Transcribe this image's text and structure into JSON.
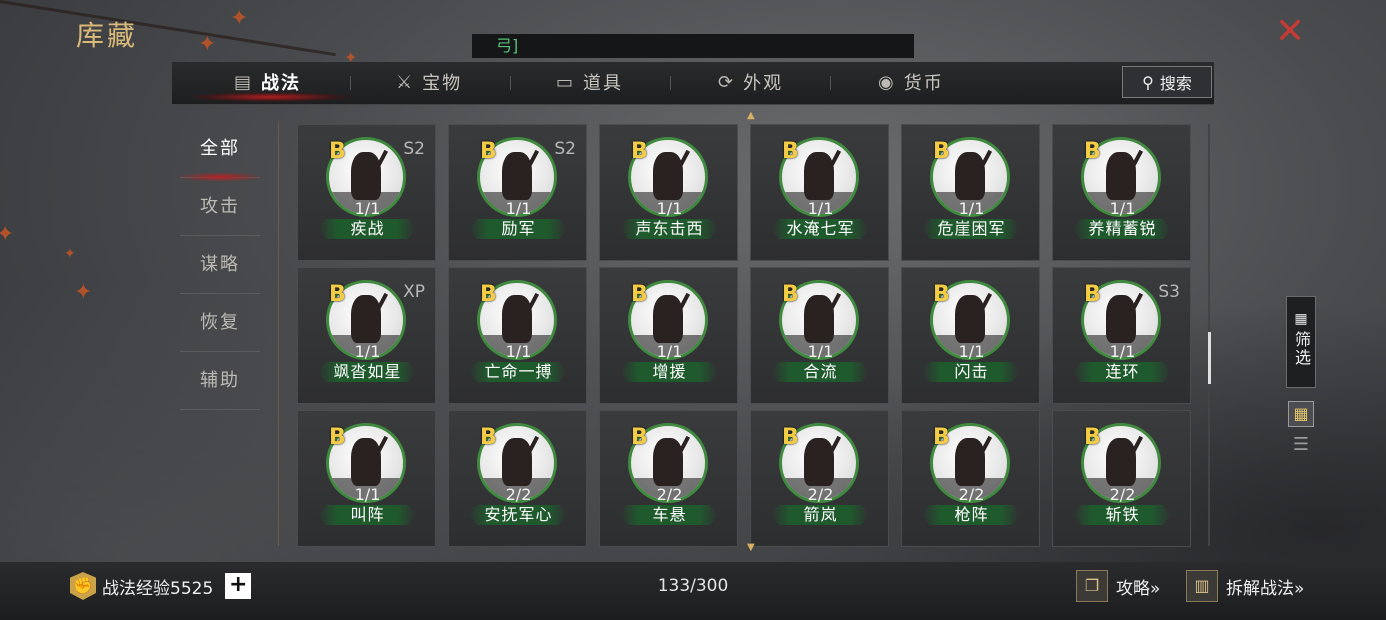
{
  "header": {
    "title": "库藏",
    "notice": "弓]",
    "close_label": "✕"
  },
  "tabs": [
    {
      "label": "战法",
      "icon": "scroll-icon",
      "glyph": "▤",
      "active": true
    },
    {
      "label": "宝物",
      "icon": "treasure-icon",
      "glyph": "⚔",
      "active": false
    },
    {
      "label": "道具",
      "icon": "item-icon",
      "glyph": "▭",
      "active": false
    },
    {
      "label": "外观",
      "icon": "appearance-icon",
      "glyph": "⟳",
      "active": false
    },
    {
      "label": "货币",
      "icon": "currency-icon",
      "glyph": "◉",
      "active": false
    }
  ],
  "search": {
    "label": "搜索",
    "icon": "search-icon"
  },
  "sidebar": {
    "items": [
      {
        "label": "全部",
        "active": true
      },
      {
        "label": "攻击",
        "active": false
      },
      {
        "label": "谋略",
        "active": false
      },
      {
        "label": "恢复",
        "active": false
      },
      {
        "label": "辅助",
        "active": false
      }
    ]
  },
  "cards": [
    {
      "grade": "B",
      "season": "S2",
      "count": "1/1",
      "name": "疾战"
    },
    {
      "grade": "B",
      "season": "S2",
      "count": "1/1",
      "name": "励军"
    },
    {
      "grade": "B",
      "season": "",
      "count": "1/1",
      "name": "声东击西"
    },
    {
      "grade": "B",
      "season": "",
      "count": "1/1",
      "name": "水淹七军"
    },
    {
      "grade": "B",
      "season": "",
      "count": "1/1",
      "name": "危崖困军"
    },
    {
      "grade": "B",
      "season": "",
      "count": "1/1",
      "name": "养精蓄锐"
    },
    {
      "grade": "B",
      "season": "XP",
      "count": "1/1",
      "name": "飒沓如星"
    },
    {
      "grade": "B",
      "season": "",
      "count": "1/1",
      "name": "亡命一搏"
    },
    {
      "grade": "B",
      "season": "",
      "count": "1/1",
      "name": "增援"
    },
    {
      "grade": "B",
      "season": "",
      "count": "1/1",
      "name": "合流"
    },
    {
      "grade": "B",
      "season": "",
      "count": "1/1",
      "name": "闪击"
    },
    {
      "grade": "B",
      "season": "S3",
      "count": "1/1",
      "name": "连环"
    },
    {
      "grade": "B",
      "season": "",
      "count": "1/1",
      "name": "叫阵"
    },
    {
      "grade": "B",
      "season": "",
      "count": "2/2",
      "name": "安抚军心"
    },
    {
      "grade": "B",
      "season": "",
      "count": "2/2",
      "name": "车悬"
    },
    {
      "grade": "B",
      "season": "",
      "count": "2/2",
      "name": "箭岚"
    },
    {
      "grade": "B",
      "season": "",
      "count": "2/2",
      "name": "枪阵"
    },
    {
      "grade": "B",
      "season": "",
      "count": "2/2",
      "name": "斩铁"
    }
  ],
  "filter": {
    "label": "筛选",
    "icon": "filter-icon"
  },
  "view": {
    "grid_icon": "grid-view-icon",
    "list_icon": "list-view-icon"
  },
  "bottom": {
    "exp_label": "战法经验5525",
    "plus": "+",
    "capacity": "133/300",
    "guide": "攻略»",
    "dismantle": "拆解战法»"
  },
  "colors": {
    "grade_gold": "#f3cb45",
    "title_gold": "#d9b97a",
    "close_red": "#c43a34",
    "notice_green": "#58c07a",
    "name_bar_green": "#1f5a2d",
    "portrait_ring": "#3f8a3e"
  }
}
